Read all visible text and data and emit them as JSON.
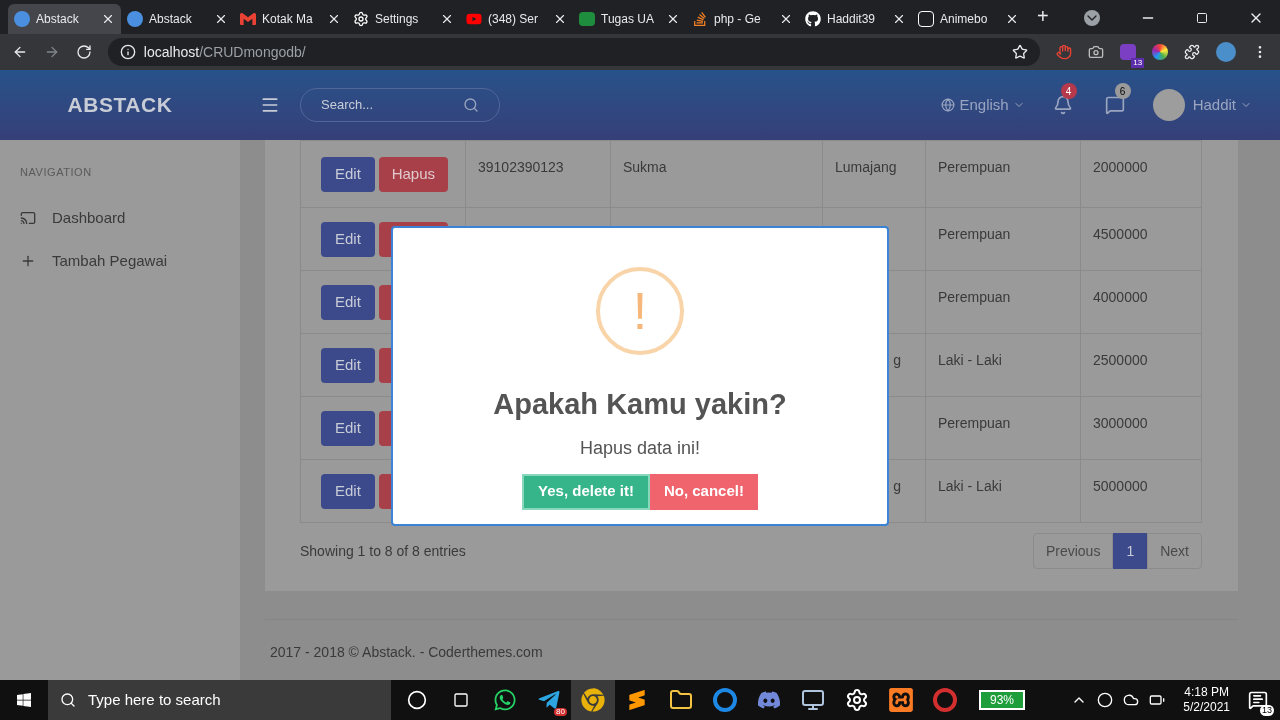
{
  "browser": {
    "tabs": [
      {
        "title": "Abstack",
        "kind": "abstack",
        "selected": true
      },
      {
        "title": "Abstack",
        "kind": "abstack",
        "selected": false
      },
      {
        "title": "Kotak Ma",
        "kind": "mail",
        "selected": false
      },
      {
        "title": "Settings",
        "kind": "gear",
        "selected": false
      },
      {
        "title": "(348) Ser",
        "kind": "video",
        "selected": false
      },
      {
        "title": "Tugas UA",
        "kind": "classroom",
        "selected": false
      },
      {
        "title": "php - Ge",
        "kind": "stack",
        "selected": false
      },
      {
        "title": "Haddit39",
        "kind": "github",
        "selected": false
      },
      {
        "title": "Animebo",
        "kind": "anime",
        "selected": false
      }
    ],
    "new_tab": "+",
    "url_host": "localhost",
    "url_path": "/CRUDmongodb/",
    "extension_badge": "13"
  },
  "header": {
    "brand": "ABSTACK",
    "search_placeholder": "Search...",
    "language": "English",
    "notifications": "4",
    "messages": "6",
    "user": "Haddit"
  },
  "sidebar": {
    "heading": "NAVIGATION",
    "items": [
      {
        "label": "Dashboard",
        "kind": "monitor"
      },
      {
        "label": "Tambah Pegawai",
        "kind": "plus"
      }
    ]
  },
  "table": {
    "rows": [
      {
        "actions": [
          {
            "kind": "edit",
            "label": "Edit"
          },
          {
            "kind": "delete",
            "label": "Hapus"
          }
        ],
        "nik": "39102390123",
        "name": "Sukma",
        "city": "Lumajang",
        "gender": "Perempuan",
        "salary": "2000000"
      },
      {
        "actions": [
          {
            "kind": "edit",
            "label": "Edit"
          },
          {
            "kind": "delete"
          }
        ],
        "gender": "Perempuan",
        "salary": "4500000"
      },
      {
        "actions": [
          {
            "kind": "edit",
            "label": "Edit"
          },
          {
            "kind": "delete"
          }
        ],
        "gender": "Perempuan",
        "salary": "4000000"
      },
      {
        "actions": [
          {
            "kind": "edit",
            "label": "Edit"
          },
          {
            "kind": "delete"
          }
        ],
        "city_tail": "g",
        "gender": "Laki - Laki",
        "salary": "2500000"
      },
      {
        "actions": [
          {
            "kind": "edit",
            "label": "Edit"
          },
          {
            "kind": "delete"
          }
        ],
        "gender": "Perempuan",
        "salary": "3000000"
      },
      {
        "actions": [
          {
            "kind": "edit",
            "label": "Edit"
          },
          {
            "kind": "delete"
          }
        ],
        "city_tail": "g",
        "gender": "Laki - Laki",
        "salary": "5000000"
      }
    ],
    "info": "Showing 1 to 8 of 8 entries",
    "pagination": [
      {
        "label": "Previous",
        "selected": false
      },
      {
        "label": "1",
        "selected": true
      },
      {
        "label": "Next",
        "selected": false
      }
    ]
  },
  "footer": "2017 - 2018 © Abstack. - Coderthemes.com",
  "dialog": {
    "icon": "!",
    "title": "Apakah Kamu yakin?",
    "text": "Hapus data ini!",
    "buttons": [
      {
        "kind": "confirm",
        "label": "Yes, delete it!"
      },
      {
        "kind": "cancel",
        "label": "No, cancel!"
      }
    ]
  },
  "taskbar": {
    "search_placeholder": "Type here to search",
    "apps": [
      {
        "kind": "cortana"
      },
      {
        "kind": "taskview"
      },
      {
        "kind": "whatsapp"
      },
      {
        "kind": "telegram",
        "badge": "80"
      },
      {
        "kind": "chrome"
      },
      {
        "kind": "sublime"
      },
      {
        "kind": "folder"
      },
      {
        "kind": "network"
      },
      {
        "kind": "discord"
      },
      {
        "kind": "monitor"
      },
      {
        "kind": "gear"
      },
      {
        "kind": "xampp"
      },
      {
        "kind": "recorder"
      }
    ],
    "battery": "93%",
    "time": "4:18 PM",
    "date": "5/2/2021",
    "notifications": "13"
  }
}
